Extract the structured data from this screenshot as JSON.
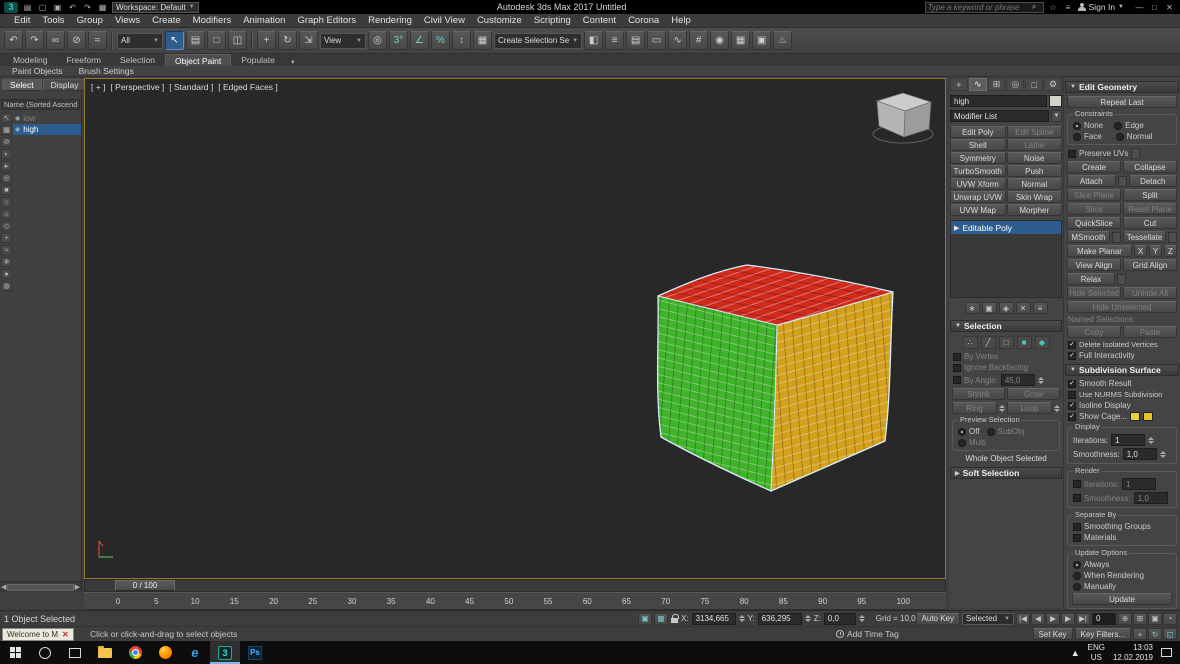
{
  "colors": {
    "accent_blue": "#2d5d8e",
    "viewport_border": "#8f7d22",
    "cube_red": "#cf2a1c",
    "cube_green": "#3fb32a",
    "cube_yellow": "#d4a11f"
  },
  "title_bar": {
    "app": "3",
    "qat_icons": [
      {
        "name": "new-scene-icon",
        "glyph": "▤"
      },
      {
        "name": "open-file-icon",
        "glyph": "▢"
      },
      {
        "name": "save-file-icon",
        "glyph": "▣"
      },
      {
        "name": "undo-small-icon",
        "glyph": "↶"
      },
      {
        "name": "redo-small-icon",
        "glyph": "↷"
      },
      {
        "name": "project-folder-icon",
        "glyph": "▦"
      }
    ],
    "workspace": "Workspace: Default",
    "title": "Autodesk 3ds Max 2017    Untitled",
    "search_placeholder": "Type a keyword or phrase",
    "help_icons": [
      {
        "name": "community-icon",
        "glyph": "☆"
      },
      {
        "name": "help-menu-icon",
        "glyph": "≡"
      }
    ],
    "sign_in": "Sign In",
    "window_icons": [
      {
        "name": "minimize-icon",
        "glyph": "—"
      },
      {
        "name": "maximize-icon",
        "glyph": "□"
      },
      {
        "name": "close-icon",
        "glyph": "✕"
      }
    ]
  },
  "menu_bar": [
    "Edit",
    "Tools",
    "Group",
    "Views",
    "Create",
    "Modifiers",
    "Animation",
    "Graph Editors",
    "Rendering",
    "Civil View",
    "Customize",
    "Scripting",
    "Content",
    "Corona",
    "Help"
  ],
  "toolbar": {
    "icons_a": [
      {
        "name": "undo-icon",
        "glyph": "↶"
      },
      {
        "name": "redo-icon",
        "glyph": "↷"
      },
      {
        "name": "select-link-icon",
        "glyph": "∞"
      },
      {
        "name": "unlink-icon",
        "glyph": "⊘"
      },
      {
        "name": "bind-spacewarp-icon",
        "glyph": "≈"
      }
    ],
    "filter_dropdown": "All",
    "icons_b": [
      {
        "name": "select-object-icon",
        "glyph": "↖",
        "active": true
      },
      {
        "name": "select-by-name-icon",
        "glyph": "▤"
      },
      {
        "name": "rect-region-icon",
        "glyph": "□"
      },
      {
        "name": "window-crossing-icon",
        "glyph": "◫"
      }
    ],
    "icons_c": [
      {
        "name": "select-move-icon",
        "glyph": "+"
      },
      {
        "name": "select-rotate-icon",
        "glyph": "↻"
      },
      {
        "name": "select-scale-icon",
        "glyph": "⇲"
      }
    ],
    "ref_dropdown": "View",
    "icons_d": [
      {
        "name": "use-pivot-icon",
        "glyph": "◎"
      },
      {
        "name": "snap-toggle-icon",
        "glyph": "3°",
        "teal": true
      },
      {
        "name": "angle-snap-icon",
        "glyph": "∠",
        "teal": true
      },
      {
        "name": "percent-snap-icon",
        "glyph": "%",
        "teal": true
      },
      {
        "name": "spinner-snap-icon",
        "glyph": "↕",
        "teal": true
      },
      {
        "name": "named-selection-sets-icon",
        "glyph": "▦"
      }
    ],
    "selection_set_dropdown": "Create Selection Se",
    "icons_e": [
      {
        "name": "mirror-icon",
        "glyph": "◧"
      },
      {
        "name": "align-icon",
        "glyph": "≡"
      },
      {
        "name": "layer-manager-icon",
        "glyph": "▤"
      },
      {
        "name": "ribbon-toggle-icon",
        "glyph": "▭"
      },
      {
        "name": "curve-editor-icon",
        "glyph": "∿"
      },
      {
        "name": "schematic-view-icon",
        "glyph": "#"
      },
      {
        "name": "material-editor-icon",
        "glyph": "◉"
      },
      {
        "name": "render-setup-icon",
        "glyph": "▦"
      },
      {
        "name": "rendered-frame-icon",
        "glyph": "▣"
      },
      {
        "name": "render-production-icon",
        "glyph": "♨"
      }
    ]
  },
  "ribbon": {
    "tabs": [
      {
        "label": "Modeling"
      },
      {
        "label": "Freeform"
      },
      {
        "label": "Selection"
      },
      {
        "label": "Object Paint",
        "active": true
      },
      {
        "label": "Populate"
      }
    ],
    "sub_tabs": [
      {
        "label": "Paint Objects"
      },
      {
        "label": "Brush Settings"
      }
    ]
  },
  "scene_explorer": {
    "tabs": [
      {
        "label": "Select",
        "active": true
      },
      {
        "label": "Display"
      }
    ],
    "header": "Name (Sorted Ascend",
    "tool_icons": [
      {
        "name": "explorer-select-icon",
        "glyph": "↖"
      },
      {
        "name": "select-all-icon",
        "glyph": "▦"
      },
      {
        "name": "select-none-icon",
        "glyph": "⊘"
      },
      {
        "name": "select-invert-icon",
        "glyph": "◐"
      },
      {
        "name": "select-children-icon",
        "glyph": "▸"
      },
      {
        "name": "find-icon",
        "glyph": "◎"
      },
      {
        "name": "filter-geometry-icon",
        "glyph": "■"
      },
      {
        "name": "filter-shapes-icon",
        "glyph": "○"
      },
      {
        "name": "filter-lights-icon",
        "glyph": "☼"
      },
      {
        "name": "filter-cameras-icon",
        "glyph": "◇"
      },
      {
        "name": "filter-helpers-icon",
        "glyph": "+"
      },
      {
        "name": "filter-spacewarps-icon",
        "glyph": "≈"
      },
      {
        "name": "freeze-icon",
        "glyph": "❄"
      },
      {
        "name": "hide-icon",
        "glyph": "●"
      },
      {
        "name": "pick-material-icon",
        "glyph": "◍"
      }
    ],
    "items": [
      {
        "name": "low",
        "dim": true
      },
      {
        "name": "high",
        "selected": true
      }
    ]
  },
  "viewport": {
    "label_parts": [
      "[ + ]",
      "[ Perspective ]",
      "[ Standard ]",
      "[ Edged Faces ]"
    ],
    "frame_slider": "0 / 100",
    "ruler_ticks": [
      "0",
      "5",
      "10",
      "15",
      "20",
      "25",
      "30",
      "35",
      "40",
      "45",
      "50",
      "55",
      "60",
      "65",
      "70",
      "75",
      "80",
      "85",
      "90",
      "95",
      "100"
    ]
  },
  "command_panel": {
    "tab_icons": [
      {
        "name": "create-tab-icon",
        "glyph": "+"
      },
      {
        "name": "modify-tab-icon",
        "glyph": "∿",
        "active": true
      },
      {
        "name": "hierarchy-tab-icon",
        "glyph": "⊞"
      },
      {
        "name": "motion-tab-icon",
        "glyph": "◎"
      },
      {
        "name": "display-tab-icon",
        "glyph": "□"
      },
      {
        "name": "utilities-tab-icon",
        "glyph": "⚙"
      }
    ],
    "object_name": "high",
    "modifier_list_label": "Modifier List",
    "modifier_buttons": [
      {
        "label": "Edit Poly"
      },
      {
        "label": "Edit Spline",
        "disabled": true
      },
      {
        "label": "Shell"
      },
      {
        "label": "Lathe",
        "disabled": true
      },
      {
        "label": "Symmetry"
      },
      {
        "label": "Noise"
      },
      {
        "label": "TurboSmooth"
      },
      {
        "label": "Push"
      },
      {
        "label": "UVW Xform"
      },
      {
        "label": "Normal"
      },
      {
        "label": "Unwrap UVW"
      },
      {
        "label": "Skin Wrap"
      },
      {
        "label": "UVW Map"
      },
      {
        "label": "Morpher"
      }
    ],
    "stack_item": "Editable Poly",
    "stack_icons": [
      {
        "name": "pin-stack-icon",
        "glyph": "∗"
      },
      {
        "name": "show-end-result-icon",
        "glyph": "▣"
      },
      {
        "name": "make-unique-icon",
        "glyph": "◈"
      },
      {
        "name": "remove-modifier-icon",
        "glyph": "✕"
      },
      {
        "name": "configure-modifier-sets-icon",
        "glyph": "≡"
      }
    ],
    "subobject_icons": [
      {
        "name": "vertex-icon",
        "glyph": "∴"
      },
      {
        "name": "edge-icon",
        "glyph": "╱"
      },
      {
        "name": "border-icon",
        "glyph": "□"
      },
      {
        "name": "polygon-icon",
        "glyph": "■",
        "teal": true
      },
      {
        "name": "element-icon",
        "glyph": "◆",
        "teal": true
      }
    ],
    "selection": {
      "title": "Selection",
      "by_vertex": "By Vertex",
      "ignore_backfacing": "Ignore Backfacing",
      "by_angle": "By Angle:",
      "by_angle_value": "45,0",
      "shrink": "Shrink",
      "grow": "Grow",
      "ring": "Ring",
      "loop": "Loop",
      "preview_title": "Preview Selection",
      "preview_options": [
        "Off",
        "SubObj",
        "Multi"
      ],
      "status": "Whole Object Selected"
    },
    "soft_selection_title": "Soft Selection",
    "edit_geometry": {
      "title": "Edit Geometry",
      "repeat_last": "Repeat Last",
      "constraints_title": "Constraints",
      "constraints": [
        "None",
        "Edge",
        "Face",
        "Normal"
      ],
      "preserve_uvs": "Preserve UVs",
      "create": "Create",
      "collapse": "Collapse",
      "attach": "Attach",
      "detach": "Detach",
      "slice_plane": "Slice Plane",
      "split": "Split",
      "slice": "Slice",
      "reset_plane": "Reset Plane",
      "quickslice": "QuickSlice",
      "cut": "Cut",
      "msmooth": "MSmooth",
      "tessellate": "Tessellate",
      "make_planar": "Make Planar",
      "x": "X",
      "y": "Y",
      "z": "Z",
      "view_align": "View Align",
      "grid_align": "Grid Align",
      "relax": "Relax",
      "hide_selected": "Hide Selected",
      "unhide_all": "Unhide All",
      "hide_unselected": "Hide Unselected",
      "named_selections": "Named Selections:",
      "copy": "Copy",
      "paste": "Paste",
      "delete_isolated": "Delete Isolated Vertices",
      "full_interactivity": "Full Interactivity"
    },
    "subdivision": {
      "title": "Subdivision Surface",
      "smooth_result": "Smooth Result",
      "use_nurms": "Use NURMS Subdivision",
      "isoline": "Isoline Display",
      "show_cage": "Show Cage...",
      "display_group": "Display",
      "iterations_label": "Iterations:",
      "iterations_value": "1",
      "smoothness_label": "Smoothness:",
      "smoothness_value": "1,0",
      "render_group": "Render",
      "render_iterations_value": "1",
      "render_smoothness_value": "1,0",
      "separate_by": "Separate By",
      "smoothing_groups": "Smoothing Groups",
      "materials": "Materials",
      "update_options": "Update Options",
      "update_radios": [
        "Always",
        "When Rendering",
        "Manually"
      ],
      "update_button": "Update"
    }
  },
  "status_bar": {
    "selected": "1 Object Selected",
    "prompt": "Click or click-and-drag to select objects",
    "welcome": "Welcome to M",
    "x_label": "X:",
    "x": "3134,665",
    "y_label": "Y:",
    "y": "636,295",
    "z_label": "Z:",
    "z": "0,0",
    "grid": "Grid = 10,0",
    "add_time_tag": "Add Time Tag",
    "auto_key": "Auto Key",
    "selected_dropdown": "Selected",
    "set_key": "Set Key",
    "key_filters": "Key Filters...",
    "frame": "0",
    "mini_icons": [
      {
        "name": "isolate-selection-icon",
        "glyph": "▣",
        "teal": true
      },
      {
        "name": "selection-lock-grid-icon",
        "glyph": "▦",
        "teal": true
      }
    ],
    "transport_icons": [
      {
        "name": "go-to-start-icon",
        "glyph": "|◀"
      },
      {
        "name": "previous-frame-icon",
        "glyph": "◀"
      },
      {
        "name": "play-icon",
        "glyph": "▶"
      },
      {
        "name": "next-frame-icon",
        "glyph": "▶"
      },
      {
        "name": "go-to-end-icon",
        "glyph": "▶|"
      }
    ],
    "nav_icons": [
      {
        "name": "zoom-icon",
        "glyph": "⊕"
      },
      {
        "name": "zoom-all-icon",
        "glyph": "⊞"
      },
      {
        "name": "zoom-extents-icon",
        "glyph": "▣"
      },
      {
        "name": "field-of-view-icon",
        "glyph": "◔"
      }
    ],
    "nav_icons2": [
      {
        "name": "pan-icon",
        "glyph": "+"
      },
      {
        "name": "orbit-icon",
        "glyph": "↻",
        "teal": true
      },
      {
        "name": "maximize-viewport-icon",
        "glyph": "◱",
        "teal": true
      }
    ]
  },
  "taskbar": {
    "lang": "ENG",
    "region": "US",
    "time": "13:03",
    "date": "12.02.2019"
  }
}
